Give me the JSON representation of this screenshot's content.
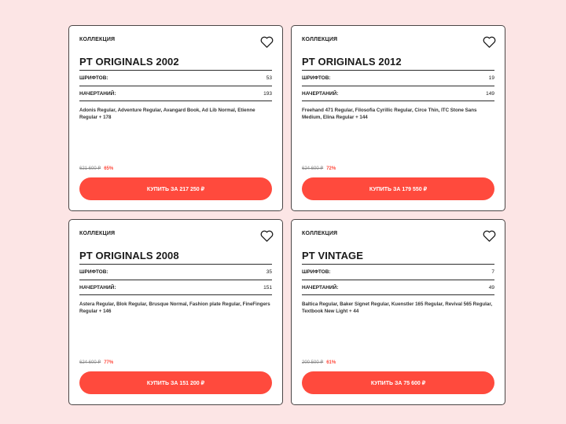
{
  "colors": {
    "accent": "#ff4a3d",
    "background": "#fce5e5",
    "border": "#4a4545"
  },
  "labels": {
    "fonts": "Шрифтов:",
    "styles": "Начертаний:"
  },
  "cards": [
    {
      "kind": "Коллекция",
      "title": "PT ORIGINALS 2002",
      "fonts": "53",
      "styles": "193",
      "style_list": "Adonis Regular, Adventure Regular, Avangard Book, Ad Lib Normal, Etienne Regular + 178",
      "old_price": "621 600 ₽",
      "discount": "65%",
      "buy_label": "Купить за 217 250 ₽",
      "favorite_icon": "heart-icon"
    },
    {
      "kind": "Коллекция",
      "title": "PT ORIGINALS 2012",
      "fonts": "19",
      "styles": "149",
      "style_list": "Freehand 471 Regular, Filosofia Cyrillic Regular, Circe Thin, ITC Stone Sans Medium, Elina Regular + 144",
      "old_price": "624 600 ₽",
      "discount": "72%",
      "buy_label": "Купить за 179 550 ₽",
      "favorite_icon": "heart-icon"
    },
    {
      "kind": "Коллекция",
      "title": "PT ORIGINALS 2008",
      "fonts": "35",
      "styles": "151",
      "style_list": "Astera Regular, Blok Regular, Brusque Normal, Fashion plate Regular, FineFingers Regular + 146",
      "old_price": "624 600 ₽",
      "discount": "77%",
      "buy_label": "Купить за 151 200 ₽",
      "favorite_icon": "heart-icon"
    },
    {
      "kind": "Коллекция",
      "title": "PT VINTAGE",
      "fonts": "7",
      "styles": "49",
      "style_list": "Baltica Regular, Baker Signet Regular, Kuenstler 165 Regular, Revival 565 Regular, Textbook New Light + 44",
      "old_price": "200 500 ₽",
      "discount": "61%",
      "buy_label": "Купить за 75 600 ₽",
      "favorite_icon": "heart-icon"
    }
  ]
}
